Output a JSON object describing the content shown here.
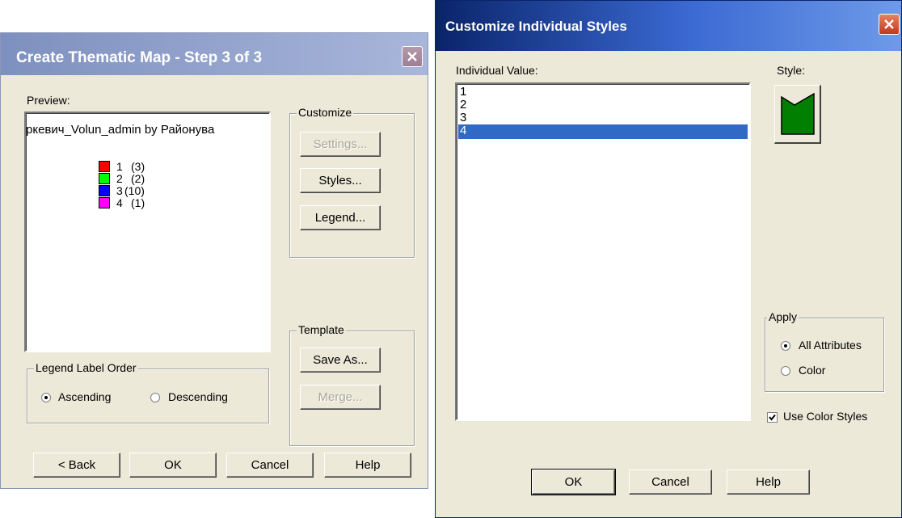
{
  "thematic": {
    "title": "Create Thematic Map - Step 3 of 3",
    "preview_label": "Preview:",
    "preview_title": "ркевич_Volun_admin by Районува",
    "legend": [
      {
        "value": "1",
        "count": "(3)",
        "color": "#ff0000"
      },
      {
        "value": "2",
        "count": "(2)",
        "color": "#00ff00"
      },
      {
        "value": "3",
        "count": "(10)",
        "color": "#0000ff"
      },
      {
        "value": "4",
        "count": "(1)",
        "color": "#ff00ff"
      }
    ],
    "customize": {
      "label": "Customize",
      "settings": "Settings...",
      "styles": "Styles...",
      "legend": "Legend..."
    },
    "template": {
      "label": "Template",
      "save_as": "Save As...",
      "merge": "Merge..."
    },
    "order": {
      "label": "Legend Label Order",
      "ascending": "Ascending",
      "descending": "Descending",
      "selected": "Ascending"
    },
    "buttons": {
      "back": "< Back",
      "ok": "OK",
      "cancel": "Cancel",
      "help": "Help"
    }
  },
  "custom": {
    "title": "Customize Individual Styles",
    "list_label": "Individual Value:",
    "values": [
      "1",
      "2",
      "3",
      "4"
    ],
    "selected_index": 3,
    "style_label": "Style:",
    "style_color": "#007f00",
    "apply": {
      "label": "Apply",
      "all": "All Attributes",
      "color": "Color",
      "selected": "All Attributes"
    },
    "use_color_styles": "Use Color Styles",
    "use_color_styles_checked": true,
    "buttons": {
      "ok": "OK",
      "cancel": "Cancel",
      "help": "Help"
    }
  }
}
